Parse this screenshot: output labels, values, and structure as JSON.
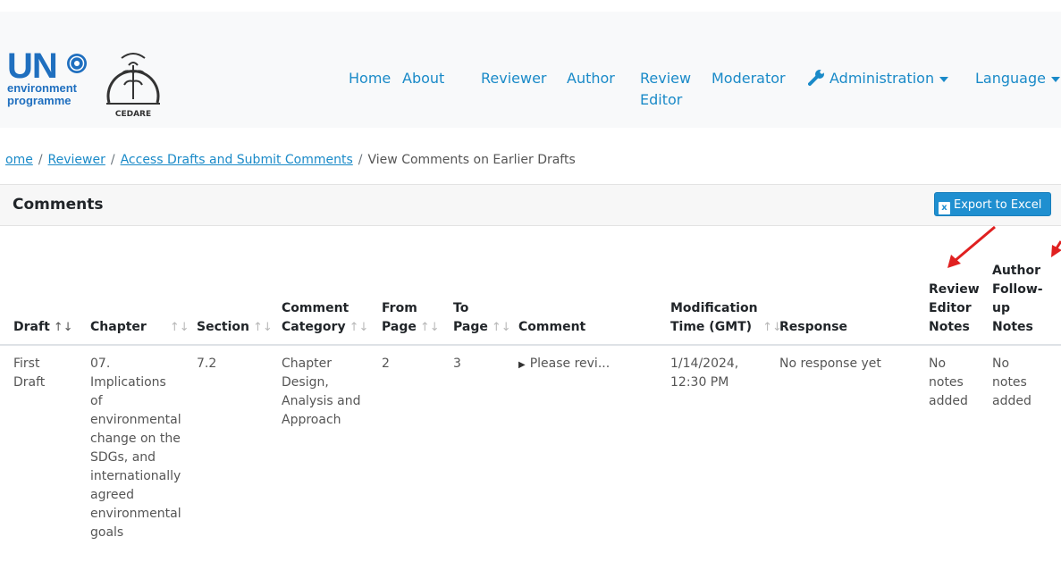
{
  "logo": {
    "un_text": "UN",
    "unep_line1": "environment",
    "unep_line2": "programme",
    "cedare_text": "CEDARE"
  },
  "nav": {
    "home": "Home",
    "about": "About",
    "reviewer": "Reviewer",
    "author": "Author",
    "review_editor_1": "Review",
    "review_editor_2": "Editor",
    "moderator": "Moderator",
    "administration": "Administration",
    "language": "Language"
  },
  "breadcrumb": {
    "home": "ome",
    "reviewer": "Reviewer",
    "access": "Access Drafts and Submit Comments",
    "current": "View Comments on Earlier Drafts",
    "separator": "/"
  },
  "card": {
    "title": "Comments",
    "export_label": "Export to Excel",
    "export_icon": "excel-icon"
  },
  "table": {
    "headers": {
      "draft": "Draft",
      "chapter": "Chapter",
      "section": "Section",
      "category_1": "Comment",
      "category_2": "Category",
      "from_1": "From",
      "from_2": "Page",
      "to_1": "To",
      "to_2": "Page",
      "comment": "Comment",
      "mod_1": "Modification",
      "mod_2": "Time (GMT)",
      "response": "Response",
      "ren_1": "Review",
      "ren_2": "Editor",
      "ren_3": "Notes",
      "afn_1": "Author",
      "afn_2": "Follow-",
      "afn_3": "up",
      "afn_4": "Notes"
    },
    "sort_active": "↑↓",
    "sort_idle": "↑↓",
    "row": {
      "draft_1": "First",
      "draft_2": "Draft",
      "chapter_lines": [
        "07.",
        "Implications",
        "of",
        "environmental",
        "change on the",
        "SDGs, and",
        "internationally",
        "agreed",
        "environmental",
        "goals"
      ],
      "section": "7.2",
      "category_lines": [
        "Chapter",
        "Design,",
        "Analysis and",
        "Approach"
      ],
      "from_page": "2",
      "to_page": "3",
      "comment": "Please revi...",
      "mod_1": "1/14/2024,",
      "mod_2": "12:30 PM",
      "response": "No response yet",
      "ren_1": "No",
      "ren_2": "notes",
      "ren_3": "added",
      "afn_1": "No",
      "afn_2": "notes",
      "afn_3": "added"
    }
  },
  "colors": {
    "link": "#1a8ac8",
    "unep_blue": "#1f6fbf",
    "button": "#1f8fd0",
    "annotation_arrow": "#e02020"
  }
}
